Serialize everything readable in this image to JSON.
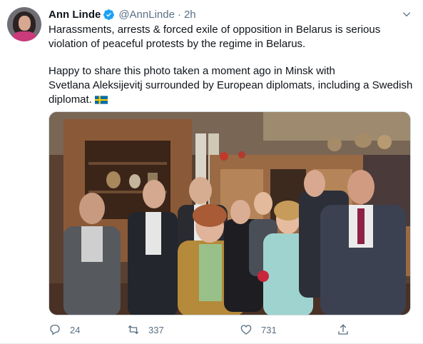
{
  "tweet": {
    "author": {
      "display_name": "Ann Linde",
      "handle": "@AnnLinde",
      "verified": true
    },
    "separator": "·",
    "time": "2h",
    "text_lines": [
      "Harassments, arrests & forced exile of opposition in Belarus is serious",
      "violation of peaceful protests  by the regime in Belarus."
    ],
    "text_lines_2": [
      "Happy to share this photo taken a moment ago in Minsk with",
      "Svetlana Aleksijevitj surrounded by European diplomats, including a Swedish",
      "diplomat."
    ],
    "flag_emoji": "🇸🇪",
    "media": {
      "alt": ""
    },
    "stats": {
      "replies": "24",
      "retweets": "337",
      "likes": "731"
    },
    "icons": {
      "reply": "reply-icon",
      "retweet": "retweet-icon",
      "like": "heart-icon",
      "share": "share-icon",
      "more": "chevron-down-icon",
      "verified": "verified-badge-icon"
    },
    "colors": {
      "text": "#0f1419",
      "secondary": "#5b7083",
      "verified": "#1da1f2",
      "border": "#e6ecf0"
    }
  }
}
